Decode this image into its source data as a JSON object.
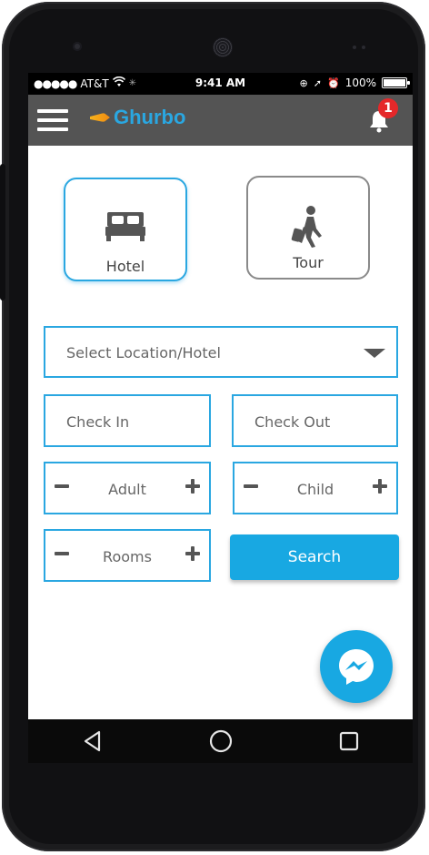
{
  "status": {
    "carrier": "AT&T",
    "time": "9:41 AM",
    "battery": "100%",
    "battery_level": 1.0
  },
  "appbar": {
    "brand": "Ghurbo",
    "notification_count": "1"
  },
  "categories": [
    {
      "label": "Hotel",
      "icon": "bed-icon",
      "selected": true
    },
    {
      "label": "Tour",
      "icon": "traveler-icon",
      "selected": false
    }
  ],
  "form": {
    "location_placeholder": "Select Location/Hotel",
    "checkin_placeholder": "Check In",
    "checkout_placeholder": "Check Out",
    "adult_label": "Adult",
    "child_label": "Child",
    "rooms_label": "Rooms",
    "search_label": "Search"
  },
  "colors": {
    "accent": "#18a8e2",
    "appbar": "#545454",
    "badge": "#e5282a"
  }
}
